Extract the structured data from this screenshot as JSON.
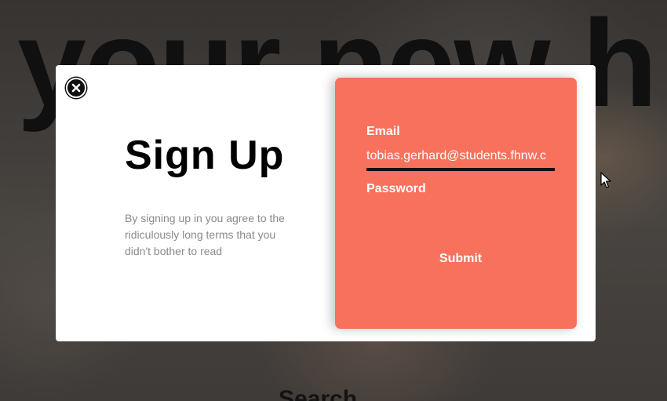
{
  "background": {
    "hero_text": "your new h",
    "section_heading": "Search"
  },
  "modal": {
    "title": "Sign Up",
    "description": "By signing up in you agree to the ridiculously long terms that you didn't bother to read",
    "close_icon": "close-icon",
    "form": {
      "accent_color": "#f7715d",
      "email_label": "Email",
      "email_value": "tobias.gerhard@students.fhnw.c",
      "password_label": "Password",
      "password_value": "",
      "submit_label": "Submit"
    }
  }
}
